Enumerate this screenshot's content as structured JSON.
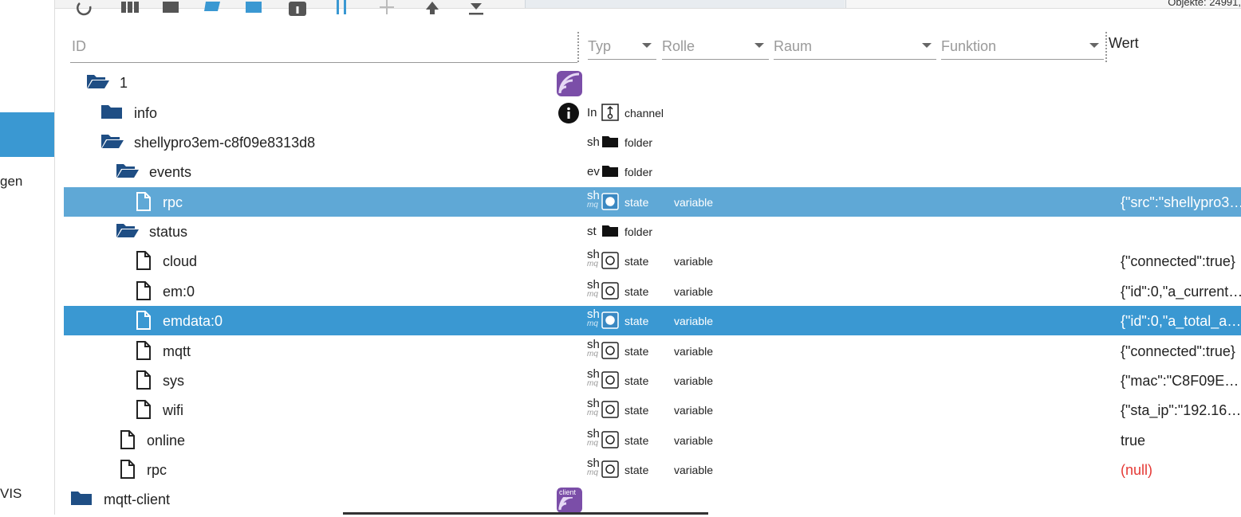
{
  "header": {
    "object_count": "Objekte: 24991,"
  },
  "sidebar": {
    "items": [
      "gen",
      "VIS"
    ]
  },
  "toolbar": {
    "icons": [
      "refresh-icon",
      "columns-icon",
      "list-icon",
      "folder-open-icon",
      "folder-icon",
      "info-icon",
      "expand-icon",
      "add-icon",
      "upload-icon",
      "download-icon"
    ]
  },
  "columns": {
    "id_placeholder": "ID",
    "typ": "Typ",
    "rolle": "Rolle",
    "raum": "Raum",
    "funktion": "Funktion",
    "wert": "Wert"
  },
  "rows": [
    {
      "name": "1",
      "icon": "folder-open-icon",
      "abbr": "",
      "sub": "",
      "type": "",
      "role": "",
      "value": ""
    },
    {
      "name": "info",
      "icon": "folder-icon",
      "abbr": "In",
      "sub": "",
      "type": "channel",
      "role": "",
      "value": ""
    },
    {
      "name": "shellypro3em-c8f09e8313d8",
      "icon": "folder-open-icon",
      "abbr": "sh",
      "sub": "",
      "type": "folder",
      "role": "",
      "value": ""
    },
    {
      "name": "events",
      "icon": "folder-open-icon",
      "abbr": "ev",
      "sub": "",
      "type": "folder",
      "role": "",
      "value": ""
    },
    {
      "name": "rpc",
      "icon": "file-icon",
      "abbr": "sh",
      "sub": "mq",
      "type": "state",
      "role": "variable",
      "value": "{\"src\":\"shellypro3…"
    },
    {
      "name": "status",
      "icon": "folder-open-icon",
      "abbr": "st",
      "sub": "",
      "type": "folder",
      "role": "",
      "value": ""
    },
    {
      "name": "cloud",
      "icon": "file-icon",
      "abbr": "sh",
      "sub": "mq",
      "type": "state",
      "role": "variable",
      "value": "{\"connected\":true}"
    },
    {
      "name": "em:0",
      "icon": "file-icon",
      "abbr": "sh",
      "sub": "mq",
      "type": "state",
      "role": "variable",
      "value": "{\"id\":0,\"a_current…"
    },
    {
      "name": "emdata:0",
      "icon": "file-icon",
      "abbr": "sh",
      "sub": "mq",
      "type": "state",
      "role": "variable",
      "value": "{\"id\":0,\"a_total_a…"
    },
    {
      "name": "mqtt",
      "icon": "file-icon",
      "abbr": "sh",
      "sub": "mq",
      "type": "state",
      "role": "variable",
      "value": "{\"connected\":true}"
    },
    {
      "name": "sys",
      "icon": "file-icon",
      "abbr": "sh",
      "sub": "mq",
      "type": "state",
      "role": "variable",
      "value": "{\"mac\":\"C8F09E…"
    },
    {
      "name": "wifi",
      "icon": "file-icon",
      "abbr": "sh",
      "sub": "mq",
      "type": "state",
      "role": "variable",
      "value": "{\"sta_ip\":\"192.16…"
    },
    {
      "name": "online",
      "icon": "file-icon",
      "abbr": "sh",
      "sub": "mq",
      "type": "state",
      "role": "variable",
      "value": "true"
    },
    {
      "name": "rpc",
      "icon": "file-icon",
      "abbr": "sh",
      "sub": "mq",
      "type": "state",
      "role": "variable",
      "value": "(null)"
    },
    {
      "name": "mqtt-client",
      "icon": "folder-icon",
      "abbr": "",
      "sub": "",
      "type": "",
      "role": "",
      "value": ""
    }
  ],
  "badges": {
    "client_label": "client"
  },
  "colors": {
    "selected_light": "#5fa8d6",
    "selected_dark": "#3a98d2",
    "folder": "#1f4e84",
    "null_value": "#e53935"
  }
}
